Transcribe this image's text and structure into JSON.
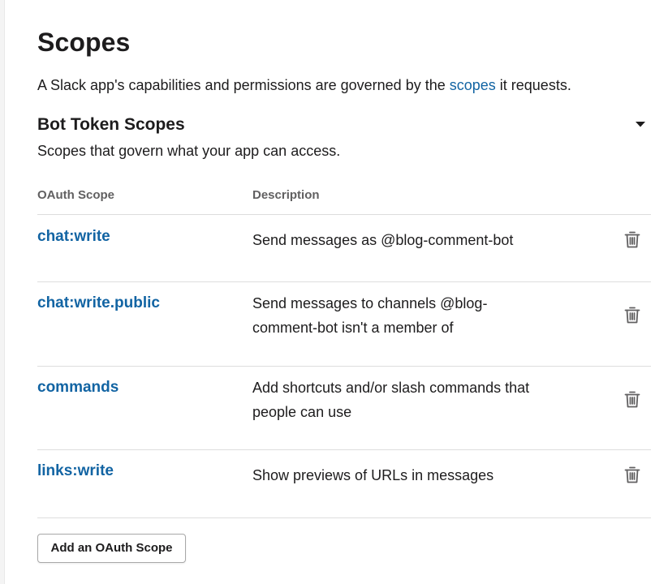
{
  "page": {
    "title": "Scopes",
    "intro_before": "A Slack app's capabilities and permissions are governed by the ",
    "intro_link": "scopes",
    "intro_after": " it requests."
  },
  "bot_scopes": {
    "title": "Bot Token Scopes",
    "subtitle": "Scopes that govern what your app can access.",
    "columns": {
      "scope": "OAuth Scope",
      "description": "Description"
    },
    "rows": [
      {
        "scope": "chat:write",
        "description": "Send messages as @blog-comment-bot"
      },
      {
        "scope": "chat:write.public",
        "description": "Send messages to channels @blog-comment-bot isn't a member of"
      },
      {
        "scope": "commands",
        "description": "Add shortcuts and/or slash commands that people can use"
      },
      {
        "scope": "links:write",
        "description": "Show previews of URLs in messages"
      }
    ],
    "add_button_label": "Add an OAuth Scope"
  },
  "icons": {
    "collapse": "caret-down-icon",
    "remove": "trash-icon"
  },
  "colors": {
    "link": "#1264a3",
    "text": "#1d1c1d",
    "muted": "#616061",
    "divider": "#dddddd"
  }
}
